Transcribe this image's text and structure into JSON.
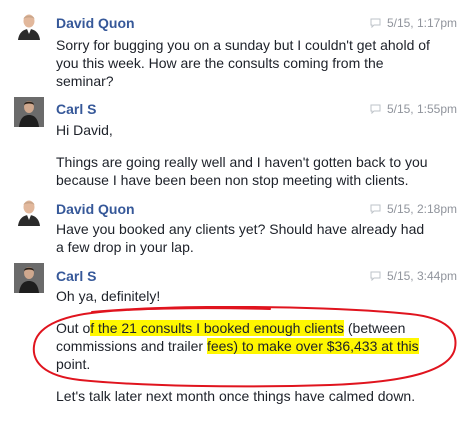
{
  "messages": [
    {
      "sender": "David Quon",
      "time": "5/15, 1:17pm",
      "avatar": "person-avatar-light",
      "lines": [
        "Sorry for bugging you on a sunday but I couldn't get ahold of",
        "you this week. How are the consults coming from the",
        "seminar?"
      ]
    },
    {
      "sender": "Carl S",
      "time": "5/15, 1:55pm",
      "avatar": "person-avatar-dark",
      "lines": [
        "Hi David,",
        "Things are going really well and I haven't gotten back to you",
        "because I have been been non stop meeting with clients."
      ]
    },
    {
      "sender": "David Quon",
      "time": "5/15, 2:18pm",
      "avatar": "person-avatar-light",
      "lines": [
        "Have you booked any clients yet? Should have already had",
        "a few drop in your lap."
      ]
    },
    {
      "sender": "Carl S",
      "time": "5/15, 3:44pm",
      "avatar": "person-avatar-dark",
      "lines": [
        "Oh ya, definitely!",
        {
          "p1": "Out o",
          "h1": "f the 21 consults I booked enough clients",
          "p2": " (between"
        },
        {
          "p1": "commissions and trailer ",
          "h1": "fees) to make over $36,433 at this"
        },
        "point.",
        "Let's talk later next month once things have calmed down."
      ]
    }
  ],
  "annotation": {
    "color": "#e0141e",
    "shape": "hand-drawn-oval"
  },
  "colors": {
    "name": "#365899",
    "meta": "#90949c",
    "text": "#1d2129",
    "highlight": "#fff700"
  }
}
